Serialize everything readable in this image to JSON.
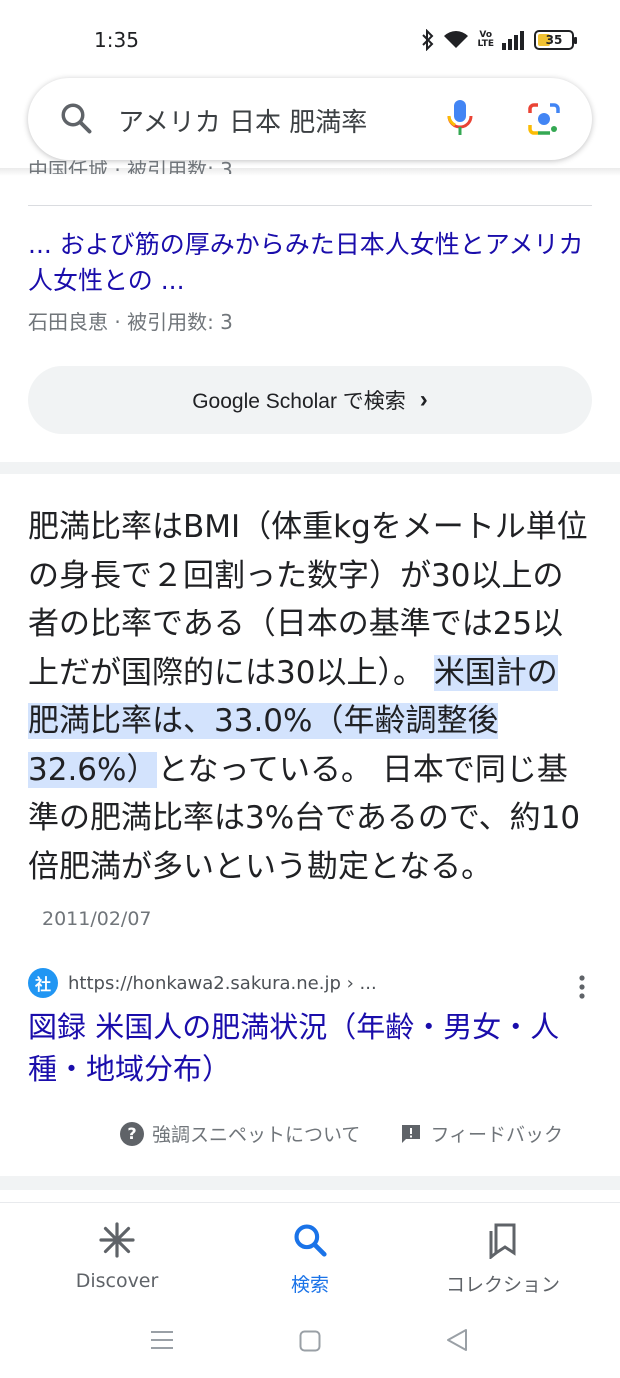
{
  "status": {
    "time": "1:35",
    "battery": "35",
    "volte": "Vo\nLTE"
  },
  "search": {
    "query": "アメリカ 日本 肥満率"
  },
  "scholar": {
    "cut_text": "中国任城 · 被引用数: 3",
    "link": "... および筋の厚みからみた日本人女性とアメリカ人女性との ...",
    "meta": "石田良恵 · 被引用数: 3",
    "button_label": "Google Scholar で検索"
  },
  "snippet": {
    "text_before": "肥満比率はBMI（体重kgをメートル単位の身長で２回割った数字）が30以上の者の比率である（日本の基準では25以上だが国際的には30以上）。 ",
    "highlight": "米国計の肥満比率は、33.0%（年齢調整後32.6%）",
    "text_after": "となっている。 日本で同じ基準の肥満比率は3%台であるので、約10倍肥満が多いという勘定となる。",
    "date": "2011/02/07",
    "source_favicon": "社",
    "source_url": "https://honkawa2.sakura.ne.jp › ...",
    "title": "図録 米国人の肥満状況（年齢・男女・人種・地域分布）",
    "about_label": "強調スニペットについて",
    "feedback_label": "フィードバック"
  },
  "bottom_nav": {
    "discover": "Discover",
    "search": "検索",
    "collections": "コレクション"
  }
}
